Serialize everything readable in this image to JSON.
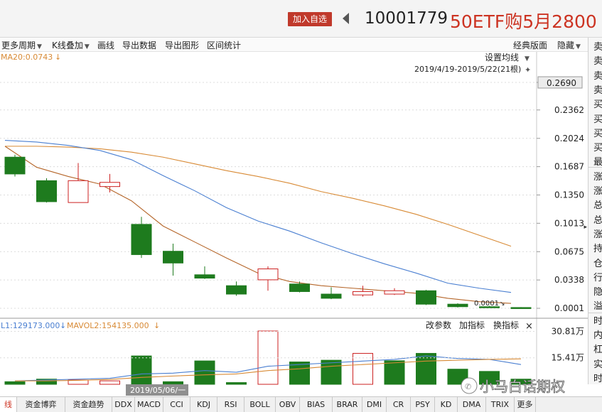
{
  "header": {
    "add_favorite_label": "加入自选",
    "code": "10001779",
    "name": "50ETF购5月2800"
  },
  "toolbar": {
    "items": [
      "更多周期",
      "K线叠加",
      "画线",
      "导出数据",
      "导出图形",
      "区间统计"
    ],
    "classic_layout": "经典版面",
    "hide": "隐藏"
  },
  "main_chart": {
    "ma_label": "MA20:0.0743",
    "ma_setting": "设置均线",
    "range_text": "2019/4/19-2019/5/22(21根)",
    "current_price_label": "0.2690",
    "min_label": "0.0001"
  },
  "volume_chart": {
    "mavol1_label": "L1:129173.000",
    "mavol2_label": "MAVOL2:154135.000",
    "buttons": [
      "改参数",
      "加指标",
      "换指标"
    ],
    "close": "×",
    "date_tag": "2019/05/06/一"
  },
  "right_panel": {
    "labels": [
      "卖",
      "卖",
      "卖",
      "卖",
      "买",
      "买",
      "买",
      "买",
      "最",
      "涨",
      "涨",
      "总",
      "总",
      "涨",
      "持",
      "仓",
      "行",
      "隐",
      "溢",
      "时",
      "内",
      "杠",
      "实",
      "时"
    ]
  },
  "tabs": [
    "线",
    "资金博弈",
    "资金趋势",
    "DDX",
    "MACD",
    "CCI",
    "KDJ",
    "RSI",
    "BOLL",
    "OBV",
    "BIAS",
    "BRAR",
    "DMI",
    "CR",
    "PSY",
    "KD",
    "DMA",
    "TRIX",
    "更多"
  ],
  "watermark": "小马白话期权",
  "colors": {
    "up": "#cc2222",
    "down": "#1e7b1e",
    "ma_orange": "#d88a35",
    "ma_blue": "#4a7fd1",
    "accent": "#c0392b"
  },
  "chart_data": [
    {
      "type": "candlestick",
      "title": "",
      "y_ticks": [
        "0.2690",
        "0.2362",
        "0.2024",
        "0.1687",
        "0.1350",
        "0.1013",
        "0.0675",
        "0.0338",
        "0.0001"
      ],
      "ylim": [
        0.0001,
        0.269
      ],
      "candles": [
        {
          "o": 0.18,
          "c": 0.16,
          "h": 0.183,
          "l": 0.157,
          "dir": "down"
        },
        {
          "o": 0.152,
          "c": 0.127,
          "h": 0.155,
          "l": 0.126,
          "dir": "down"
        },
        {
          "o": 0.126,
          "c": 0.152,
          "h": 0.173,
          "l": 0.126,
          "dir": "up"
        },
        {
          "o": 0.145,
          "c": 0.15,
          "h": 0.16,
          "l": 0.138,
          "dir": "up"
        },
        {
          "o": 0.1,
          "c": 0.064,
          "h": 0.109,
          "l": 0.06,
          "dir": "down"
        },
        {
          "o": 0.068,
          "c": 0.054,
          "h": 0.077,
          "l": 0.039,
          "dir": "down"
        },
        {
          "o": 0.04,
          "c": 0.036,
          "h": 0.05,
          "l": 0.035,
          "dir": "down"
        },
        {
          "o": 0.027,
          "c": 0.017,
          "h": 0.032,
          "l": 0.015,
          "dir": "down"
        },
        {
          "o": 0.034,
          "c": 0.047,
          "h": 0.05,
          "l": 0.021,
          "dir": "up"
        },
        {
          "o": 0.029,
          "c": 0.02,
          "h": 0.032,
          "l": 0.019,
          "dir": "down"
        },
        {
          "o": 0.017,
          "c": 0.012,
          "h": 0.025,
          "l": 0.011,
          "dir": "down"
        },
        {
          "o": 0.016,
          "c": 0.02,
          "h": 0.027,
          "l": 0.014,
          "dir": "up"
        },
        {
          "o": 0.017,
          "c": 0.021,
          "h": 0.024,
          "l": 0.016,
          "dir": "up"
        },
        {
          "o": 0.021,
          "c": 0.005,
          "h": 0.022,
          "l": 0.004,
          "dir": "down"
        },
        {
          "o": 0.005,
          "c": 0.002,
          "h": 0.006,
          "l": 0.001,
          "dir": "down"
        },
        {
          "o": 0.002,
          "c": 0.001,
          "h": 0.003,
          "l": 0.0005,
          "dir": "down"
        },
        {
          "o": 0.001,
          "c": 0.0008,
          "h": 0.0015,
          "l": 0.0001,
          "dir": "down"
        }
      ],
      "ma_orange_dark": [
        0.193,
        0.168,
        0.157,
        0.148,
        0.128,
        0.098,
        0.079,
        0.06,
        0.042,
        0.032,
        0.027,
        0.024,
        0.021,
        0.018,
        0.012,
        0.008,
        0.006
      ],
      "ma_blue": [
        0.2,
        0.198,
        0.194,
        0.188,
        0.177,
        0.158,
        0.14,
        0.12,
        0.104,
        0.092,
        0.078,
        0.065,
        0.053,
        0.042,
        0.03,
        0.024,
        0.019
      ],
      "ma_orange_light": [
        0.193,
        0.193,
        0.192,
        0.19,
        0.186,
        0.18,
        0.172,
        0.164,
        0.157,
        0.149,
        0.139,
        0.131,
        0.122,
        0.112,
        0.1,
        0.087,
        0.074
      ]
    },
    {
      "type": "bar",
      "title": "",
      "y_ticks": [
        "30.81万",
        "15.41万"
      ],
      "ylim": [
        0,
        31
      ],
      "values": [
        1.5,
        3.0,
        2.5,
        2.0,
        16.5,
        1.5,
        13.6,
        1.0,
        31.0,
        13.0,
        14.0,
        18.0,
        13.7,
        18.0,
        8.8,
        7.5,
        3.0
      ],
      "dirs": [
        "down",
        "down",
        "up",
        "up",
        "down",
        "down",
        "down",
        "down",
        "up",
        "down",
        "down",
        "up",
        "down",
        "down",
        "down",
        "down",
        "down"
      ],
      "mavol1": [
        2.0,
        2.5,
        3.0,
        3.5,
        6.0,
        6.5,
        8.0,
        7.0,
        10.5,
        11.5,
        12.5,
        13.5,
        14.5,
        16.5,
        15.0,
        14.5,
        11.5
      ],
      "mavol2": [
        2.0,
        2.0,
        2.3,
        2.8,
        4.0,
        4.8,
        5.5,
        6.0,
        8.0,
        9.0,
        10.5,
        11.5,
        12.5,
        13.5,
        14.0,
        14.5,
        14.8
      ]
    }
  ]
}
